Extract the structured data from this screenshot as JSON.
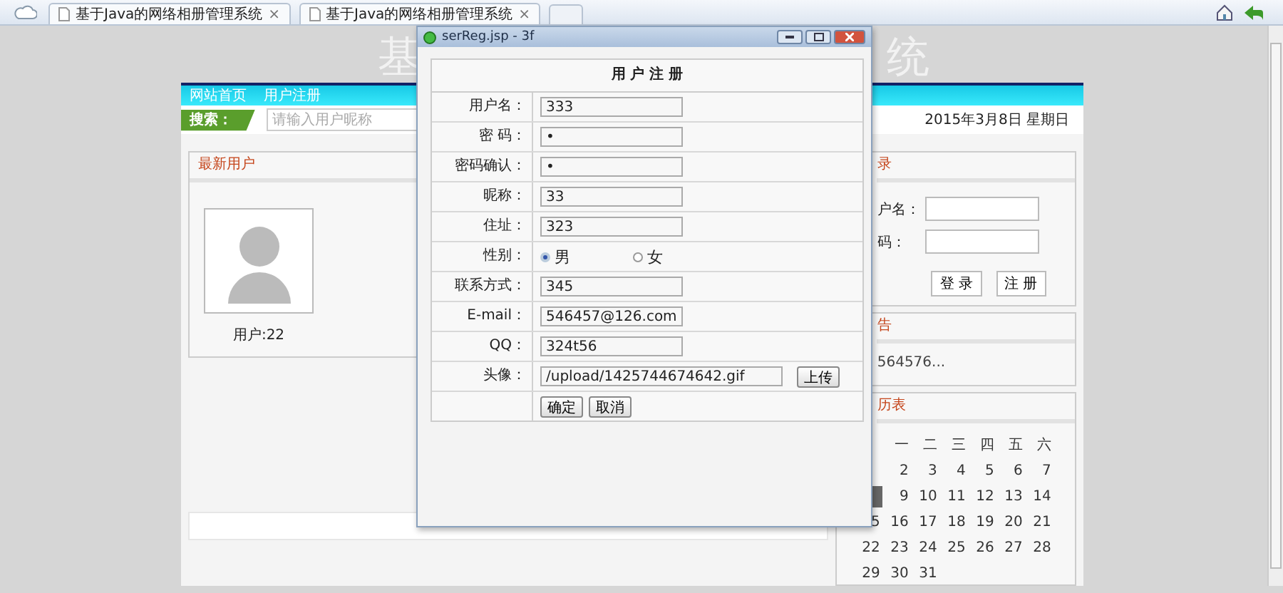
{
  "browser": {
    "tabs": [
      {
        "title": "基于Java的网络相册管理系统",
        "close": "×"
      },
      {
        "title": "基于Java的网络相册管理系统",
        "close": "×"
      }
    ]
  },
  "header": {
    "title_fragments": [
      "基",
      "统"
    ]
  },
  "nav": [
    {
      "label": "网站首页"
    },
    {
      "label": "用户注册"
    }
  ],
  "search": {
    "label": "搜索：",
    "placeholder": "请输入用户昵称",
    "date": "2015年3月8日 星期日"
  },
  "latest_users": {
    "title": "最新用户",
    "users": [
      {
        "caption": "用户:22"
      }
    ]
  },
  "login": {
    "title": "录",
    "fields": [
      {
        "label": "户名："
      },
      {
        "label": "码："
      }
    ],
    "buttons": [
      "登 录",
      "注 册"
    ]
  },
  "notice": {
    "title": "告",
    "text": "564576..."
  },
  "calendar": {
    "title": "历表",
    "weekdays": [
      "一",
      "二",
      "三",
      "四",
      "五",
      "六"
    ],
    "rows": [
      [
        {
          "today": false
        },
        {
          "text": "2",
          "today": false
        },
        {
          "text": "3",
          "today": false
        },
        {
          "text": "4",
          "today": false
        },
        {
          "text": "5",
          "today": false
        },
        {
          "text": "6",
          "today": false
        },
        {
          "text": "7",
          "today": false
        }
      ],
      [
        {
          "today": true
        },
        {
          "text": "9",
          "today": false
        },
        {
          "text": "10",
          "today": false
        },
        {
          "text": "11",
          "today": false
        },
        {
          "text": "12",
          "today": false
        },
        {
          "text": "13",
          "today": false
        },
        {
          "text": "14",
          "today": false
        }
      ],
      [
        {
          "text": "5",
          "today": false
        },
        {
          "text": "16",
          "today": false
        },
        {
          "text": "17",
          "today": false
        },
        {
          "text": "18",
          "today": false
        },
        {
          "text": "19",
          "today": false
        },
        {
          "text": "20",
          "today": false
        },
        {
          "text": "21",
          "today": false
        }
      ],
      [
        {
          "text": "22",
          "today": false
        },
        {
          "text": "23",
          "today": false
        },
        {
          "text": "24",
          "today": false
        },
        {
          "text": "25",
          "today": false
        },
        {
          "text": "26",
          "today": false
        },
        {
          "text": "27",
          "today": false
        },
        {
          "text": "28",
          "today": false
        }
      ],
      [
        {
          "text": "29",
          "today": false
        },
        {
          "text": "30",
          "today": false
        },
        {
          "text": "31",
          "today": false
        }
      ]
    ]
  },
  "dialog": {
    "title": "serReg.jsp - 3f",
    "form_title": "用 户 注 册",
    "rows": [
      {
        "kind": "text",
        "label": "用户名：",
        "value": "333"
      },
      {
        "kind": "text",
        "label": "密 码：",
        "value": "•"
      },
      {
        "kind": "text",
        "label": "密码确认：",
        "value": "•"
      },
      {
        "kind": "text",
        "label": "昵称：",
        "value": "33"
      },
      {
        "kind": "text",
        "label": "住址：",
        "value": "323"
      },
      {
        "kind": "radio",
        "label": "性别：",
        "options": [
          {
            "label": "男",
            "selected": true
          },
          {
            "label": "女",
            "selected": false
          }
        ]
      },
      {
        "kind": "text",
        "label": "联系方式：",
        "value": "345"
      },
      {
        "kind": "text",
        "label": "E-mail：",
        "value": "546457@126.com"
      },
      {
        "kind": "text",
        "label": "QQ：",
        "value": "324t56"
      },
      {
        "kind": "file",
        "label": "头像：",
        "value": "/upload/1425744674642.gif",
        "button": "上传"
      },
      {
        "kind": "buttons",
        "buttons": [
          "确定",
          "取消"
        ]
      }
    ]
  }
}
